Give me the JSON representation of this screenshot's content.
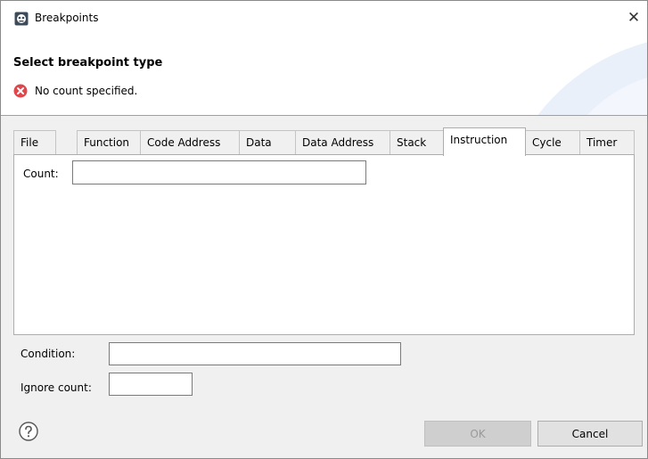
{
  "window": {
    "title": "Breakpoints",
    "close": "✕"
  },
  "banner": {
    "title": "Select breakpoint type",
    "message": "No count specified."
  },
  "tabs": [
    {
      "label": "File"
    },
    {
      "label": "Function"
    },
    {
      "label": "Code Address"
    },
    {
      "label": "Data"
    },
    {
      "label": "Data Address"
    },
    {
      "label": "Stack"
    },
    {
      "label": "Instruction",
      "active": true
    },
    {
      "label": "Cycle"
    },
    {
      "label": "Timer"
    }
  ],
  "instruction_panel": {
    "count_label": "Count:",
    "count_value": ""
  },
  "condition": {
    "label": "Condition:",
    "value": ""
  },
  "ignore_count": {
    "label": "Ignore count:",
    "value": ""
  },
  "buttons": {
    "ok": "OK",
    "cancel": "Cancel"
  },
  "colors": {
    "error": "#e0464b",
    "ok_disabled": "#cfcfcf",
    "accent_banner": "#e7eef9"
  },
  "icons": {
    "app": "breakpoints-app-icon",
    "error": "error-icon",
    "help": "help-icon"
  }
}
